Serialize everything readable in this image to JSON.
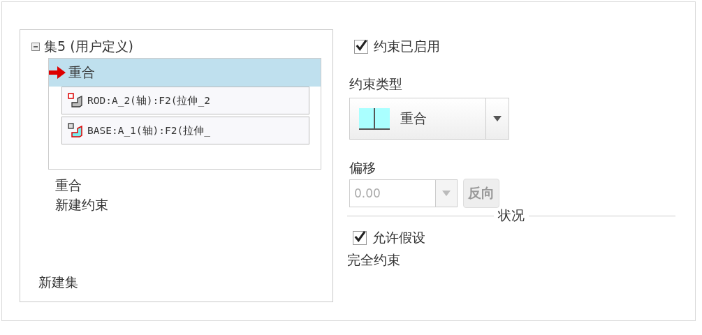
{
  "tree": {
    "set_label": "集5 (用户定义)",
    "expanded": true,
    "active_constraint": {
      "label": "重合",
      "selected": true,
      "references": [
        {
          "text": "ROD:A_2(轴):F2(拉伸_2",
          "kind": "rod"
        },
        {
          "text": "BASE:A_1(轴):F2(拉伸_",
          "kind": "base"
        }
      ]
    },
    "constraints": [
      "重合",
      "新建约束"
    ],
    "new_set": "新建集"
  },
  "constraint_enabled": {
    "label": "约束已启用",
    "checked": true
  },
  "constraint_type": {
    "label": "约束类型",
    "value": "重合"
  },
  "offset": {
    "label": "偏移",
    "value": "0.00",
    "disabled": true
  },
  "flip_button": {
    "label": "反向",
    "disabled": true
  },
  "status": {
    "title": "状况",
    "allow_assumptions": {
      "label": "允许假设",
      "checked": true
    },
    "text": "完全约束"
  }
}
